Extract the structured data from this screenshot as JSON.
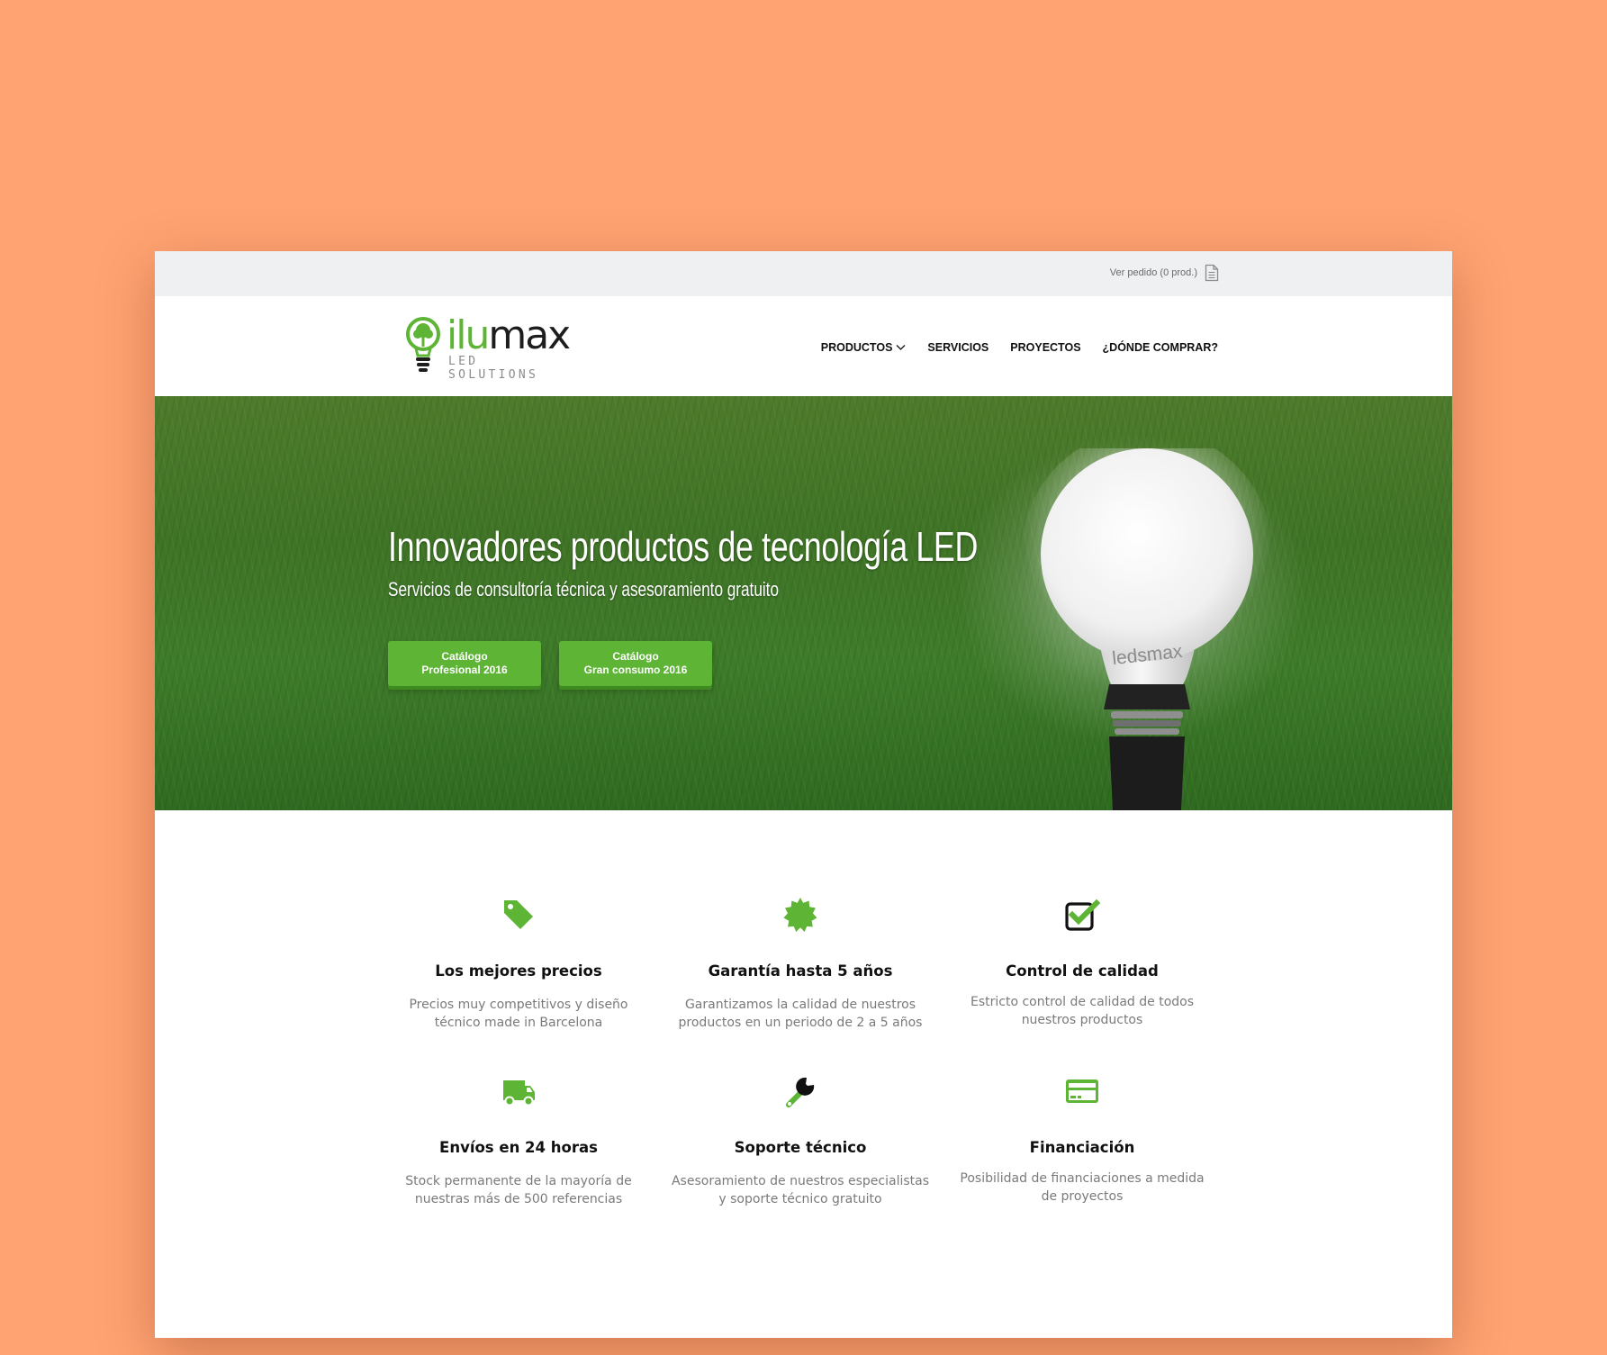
{
  "colors": {
    "background": "#FFA372",
    "brand_green": "#5DB435",
    "topbar": "#EEF0F1",
    "text_dark": "#111111",
    "text_muted": "#7A7A7A"
  },
  "topbar": {
    "order_label": "Ver pedido (0 prod.)",
    "order_icon": "document-icon"
  },
  "logo": {
    "word_green": "ilu",
    "word_dark": "max",
    "tagline": "LED SOLUTIONS",
    "icon": "lightbulb-tree-icon"
  },
  "nav": {
    "items": [
      {
        "label": "PRODUCTOS",
        "has_dropdown": true
      },
      {
        "label": "SERVICIOS"
      },
      {
        "label": "PROYECTOS"
      },
      {
        "label": "¿DÓNDE COMPRAR?"
      }
    ]
  },
  "hero": {
    "title": "Innovadores productos de tecnología LED",
    "subtitle": "Servicios de consultoría técnica y asesoramiento gratuito",
    "buttons": [
      {
        "line1": "Catálogo",
        "line2": "Profesional 2016"
      },
      {
        "line1": "Catálogo",
        "line2": "Gran consumo 2016"
      }
    ],
    "bulb_brand": "ledsmax"
  },
  "features": [
    {
      "icon": "tag-icon",
      "title": "Los mejores precios",
      "text": "Precios muy competitivos y diseño técnico made in Barcelona"
    },
    {
      "icon": "badge-icon",
      "title": "Garantía hasta 5 años",
      "text": "Garantizamos la calidad de nuestros productos en un periodo de 2 a 5 años"
    },
    {
      "icon": "checkbox-icon",
      "title": "Control de calidad",
      "text": "Estricto control de calidad de todos nuestros productos"
    },
    {
      "icon": "truck-icon",
      "title": "Envíos en 24 horas",
      "text": "Stock permanente de la mayoría de nuestras más de 500 referencias"
    },
    {
      "icon": "wrench-icon",
      "title": "Soporte técnico",
      "text": "Asesoramiento de nuestros especialistas y soporte técnico gratuito"
    },
    {
      "icon": "credit-card-icon",
      "title": "Financiación",
      "text": "Posibilidad de financiaciones a medida de proyectos"
    }
  ]
}
